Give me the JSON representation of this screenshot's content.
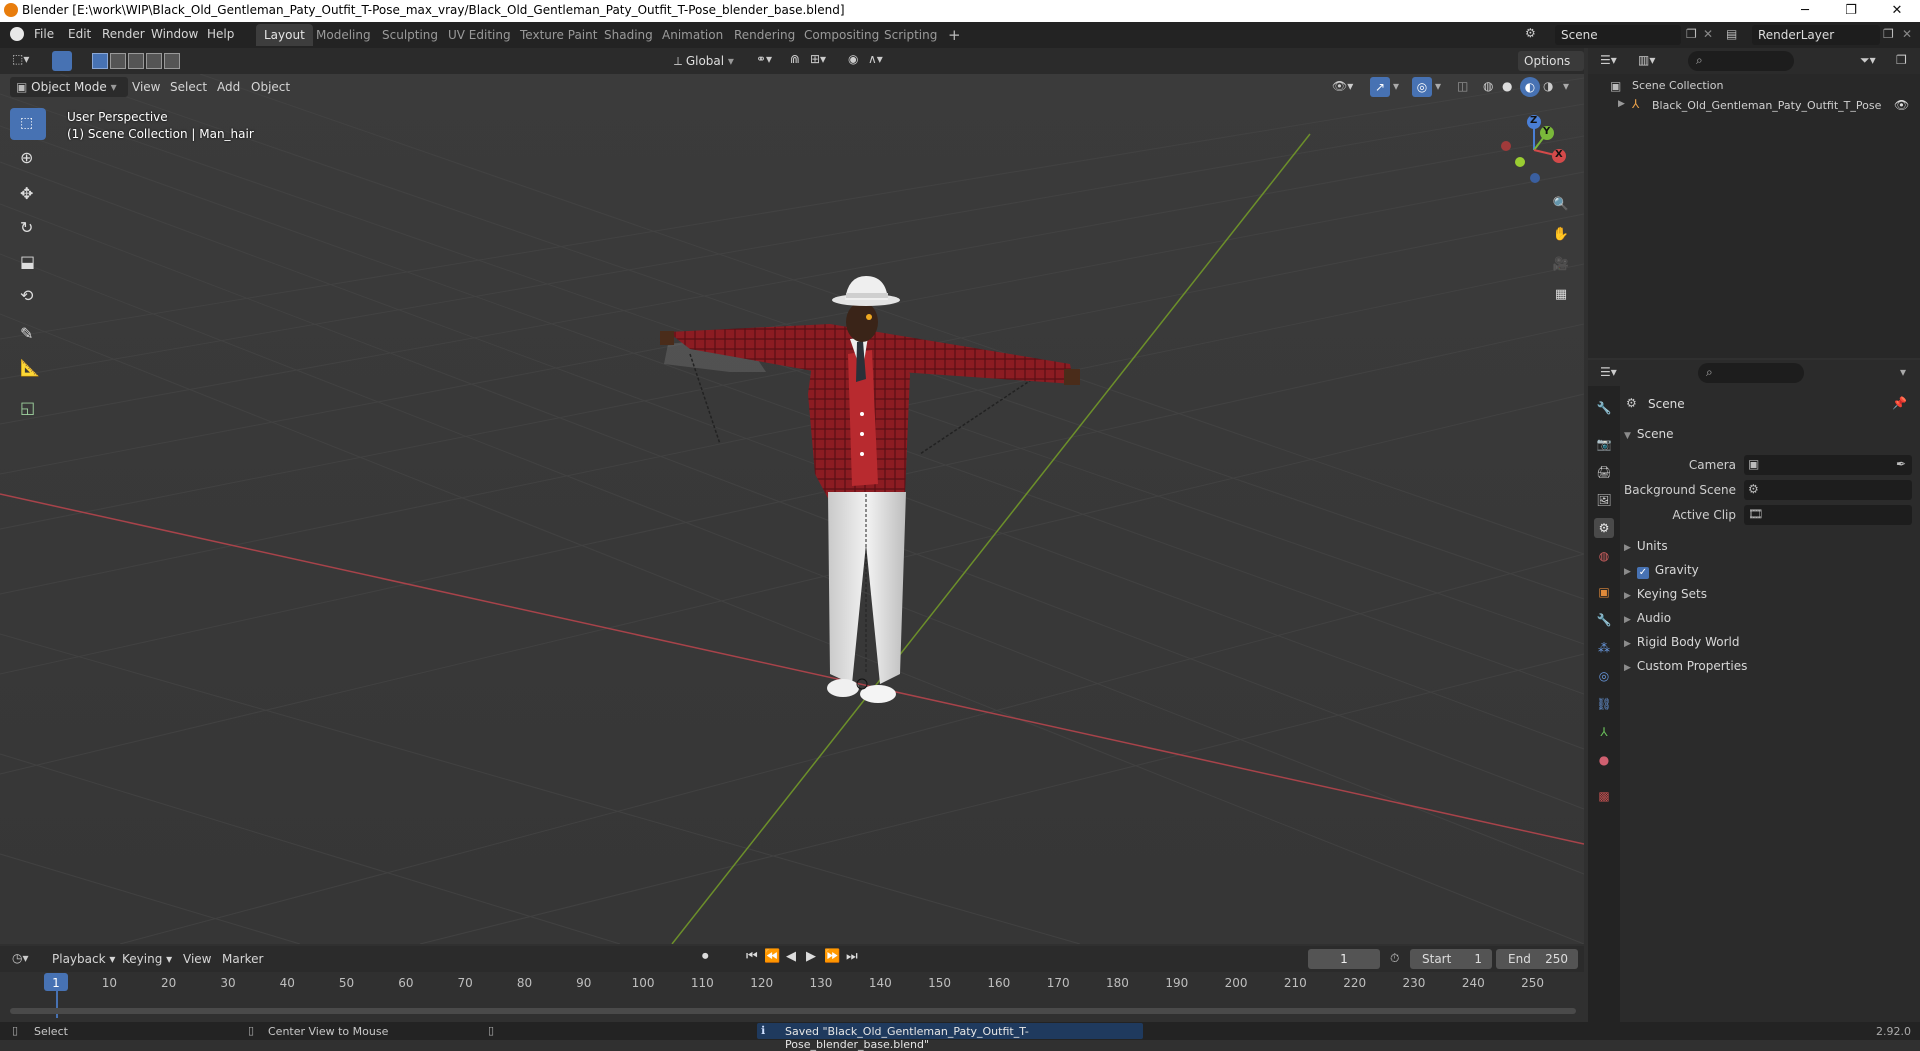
{
  "window": {
    "title": "Blender [E:\\work\\WIP\\Black_Old_Gentleman_Paty_Outfit_T-Pose_max_vray/Black_Old_Gentleman_Paty_Outfit_T-Pose_blender_base.blend]",
    "minimize": "─",
    "maximize": "❐",
    "close": "✕"
  },
  "menu": [
    "File",
    "Edit",
    "Render",
    "Window",
    "Help"
  ],
  "workspaces": [
    "Layout",
    "Modeling",
    "Sculpting",
    "UV Editing",
    "Texture Paint",
    "Shading",
    "Animation",
    "Rendering",
    "Compositing",
    "Scripting"
  ],
  "workspace_add": "+",
  "scene_selector": "Scene",
  "renderlayer_selector": "RenderLayer",
  "toolbar": {
    "transform_orientation": "Global",
    "options": "Options"
  },
  "viewport_header": {
    "mode": "Object Mode",
    "view": "View",
    "select": "Select",
    "add": "Add",
    "object": "Object"
  },
  "viewport": {
    "perspective": "User Perspective",
    "collection_info": "(1) Scene Collection | Man_hair",
    "gizmo_axes": [
      "Z",
      "Y",
      "X"
    ]
  },
  "outliner": {
    "root": "Scene Collection",
    "items": [
      "Black_Old_Gentleman_Paty_Outfit_T_Pose"
    ]
  },
  "properties": {
    "context": "Scene",
    "section": "Scene",
    "fields": [
      {
        "label": "Camera"
      },
      {
        "label": "Background Scene"
      },
      {
        "label": "Active Clip"
      }
    ],
    "panels": [
      "Units",
      "Gravity",
      "Keying Sets",
      "Audio",
      "Rigid Body World",
      "Custom Properties"
    ],
    "gravity_checked": true
  },
  "timeline": {
    "menus": [
      "Playback",
      "Keying",
      "View",
      "Marker"
    ],
    "current_frame": "1",
    "start_label": "Start",
    "start": "1",
    "end_label": "End",
    "end": "250",
    "ruler": [
      "1",
      "10",
      "20",
      "30",
      "40",
      "50",
      "60",
      "70",
      "80",
      "90",
      "100",
      "110",
      "120",
      "130",
      "140",
      "150",
      "160",
      "170",
      "180",
      "190",
      "200",
      "210",
      "220",
      "230",
      "240",
      "250"
    ]
  },
  "status": {
    "left1": "Select",
    "left2": "Center View to Mouse",
    "message": "Saved \"Black_Old_Gentleman_Paty_Outfit_T-Pose_blender_base.blend\"",
    "version": "2.92.0"
  },
  "colors": {
    "accent": "#4772b3",
    "x_axis": "#c74b4b",
    "y_axis": "#6f9a2b",
    "jacket": "#8c1c22",
    "background": "#393939"
  }
}
